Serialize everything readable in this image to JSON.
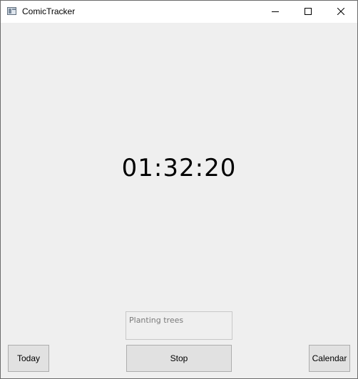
{
  "window": {
    "title": "ComicTracker"
  },
  "timer": {
    "elapsed": "01:32:20"
  },
  "task": {
    "placeholder": "Planting trees",
    "value": ""
  },
  "buttons": {
    "today_label": "Today",
    "stop_label": "Stop",
    "calendar_label": "Calendar"
  },
  "icons": {
    "app": "app-icon",
    "minimize": "minimize-icon",
    "maximize": "maximize-icon",
    "close": "close-icon"
  }
}
